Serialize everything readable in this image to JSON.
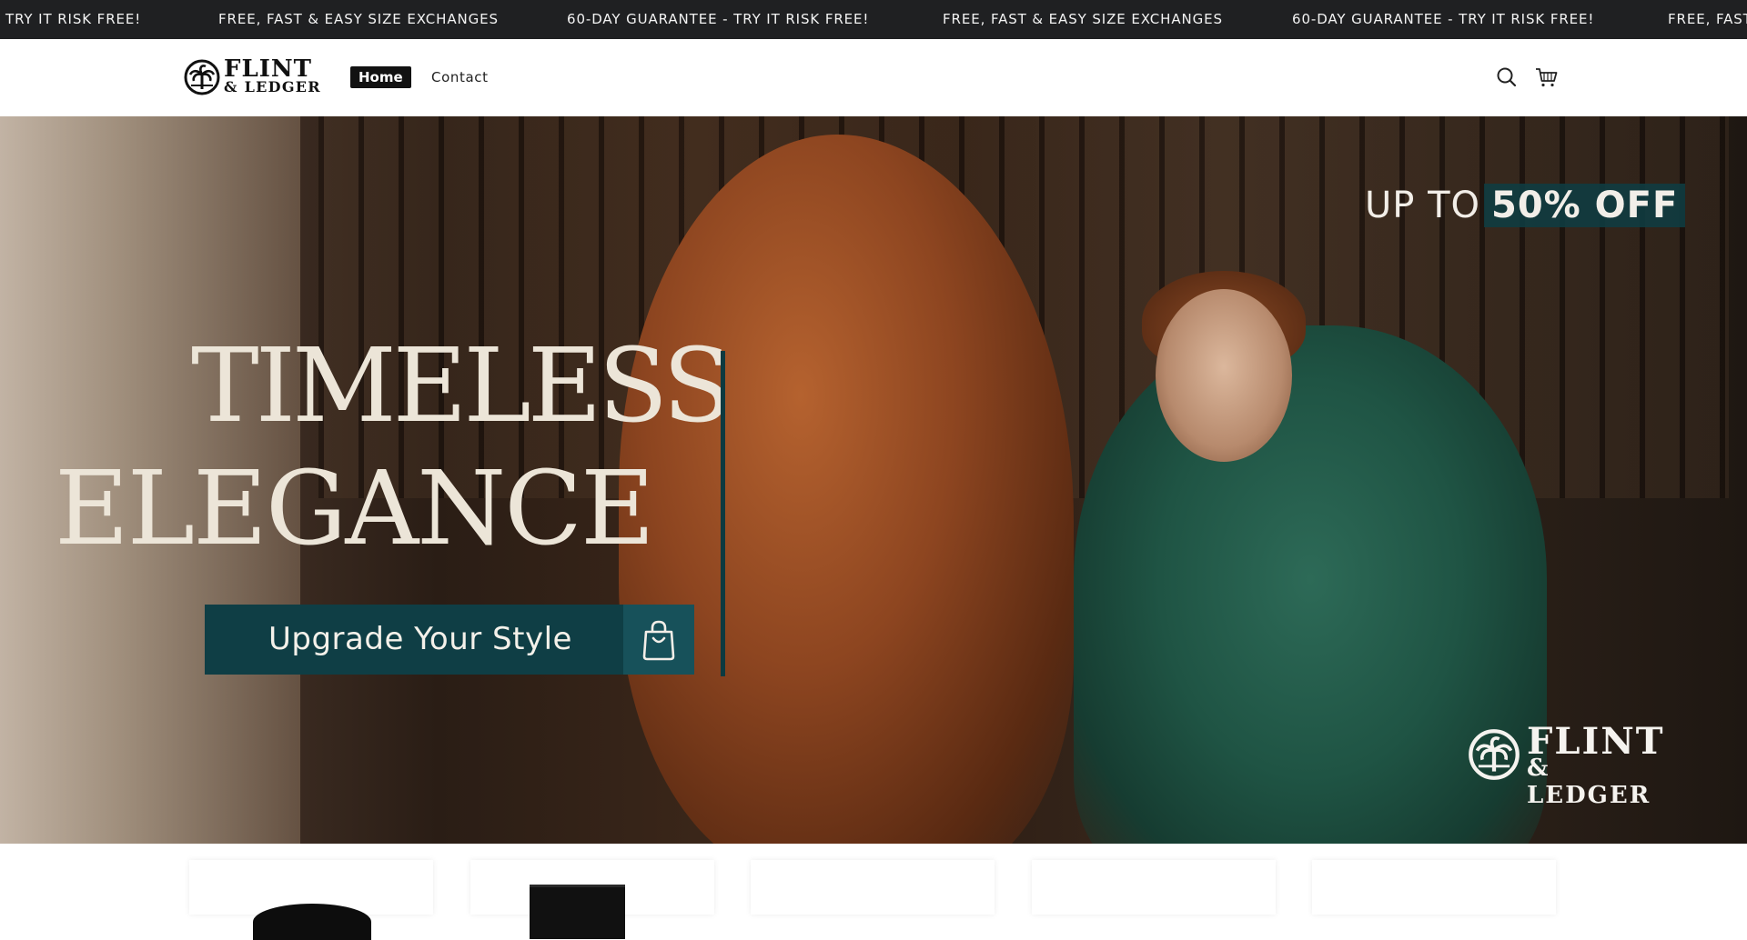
{
  "announcement": {
    "messages": [
      "TRY IT RISK FREE!",
      "FREE, FAST & EASY SIZE EXCHANGES",
      "60-DAY GUARANTEE - TRY IT RISK FREE!",
      "FREE, FAST & EASY SIZE EXCHANGES",
      "60-DAY GUARANTEE - TRY IT RISK FREE!",
      "FREE, FAST"
    ]
  },
  "header": {
    "logo": {
      "line1": "FLINT",
      "line2": "& LEDGER"
    },
    "nav": [
      {
        "label": "Home",
        "active": true
      },
      {
        "label": "Contact",
        "active": false
      }
    ],
    "icons": [
      "search-icon",
      "cart-icon"
    ]
  },
  "hero": {
    "offer_prefix": "UP TO",
    "offer_highlight": "50% OFF",
    "title_line1": "TIMELESS",
    "title_line2": "ELEGANCE",
    "cta_label": "Upgrade Your Style",
    "cta_icon": "shopping-bag-icon",
    "logo": {
      "line1": "FLINT",
      "line2": "& LEDGER"
    },
    "colors": {
      "accent": "#0f3e45",
      "title": "#ece5d8"
    }
  },
  "products": {
    "items": [
      {
        "image": "black-cap"
      },
      {
        "image": "black-shorts"
      },
      {
        "image": ""
      },
      {
        "image": ""
      },
      {
        "image": ""
      }
    ]
  }
}
